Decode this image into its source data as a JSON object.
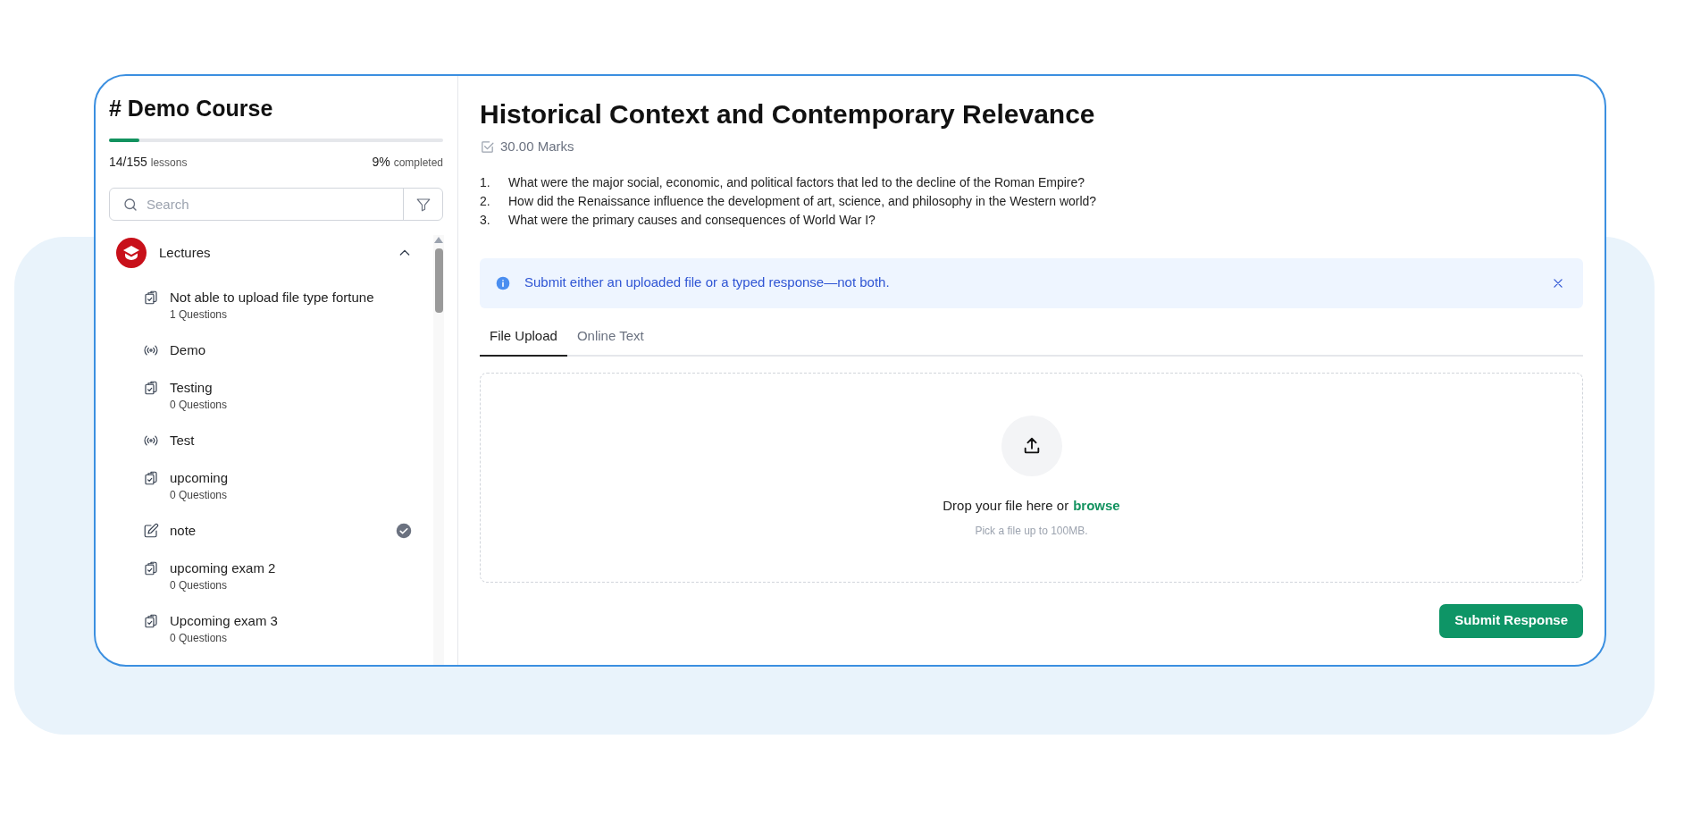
{
  "sidebar": {
    "title": "# Demo Course",
    "progress": {
      "level": 0.09,
      "count": "14/155",
      "count_label": "lessons",
      "percent": "9%",
      "percent_label": "completed"
    },
    "search": {
      "placeholder": "Search"
    },
    "section": {
      "title": "Lectures",
      "expanded": true,
      "items": [
        {
          "kind": "quiz",
          "title": "Not able to upload file type fortune",
          "subtitle": "1 Questions",
          "completed": false
        },
        {
          "kind": "live",
          "title": "Demo",
          "completed": false
        },
        {
          "kind": "quiz",
          "title": "Testing",
          "subtitle": "0 Questions",
          "completed": false
        },
        {
          "kind": "live",
          "title": "Test",
          "completed": false
        },
        {
          "kind": "quiz",
          "title": "upcoming",
          "subtitle": "0 Questions",
          "completed": false
        },
        {
          "kind": "note",
          "title": "note",
          "completed": true
        },
        {
          "kind": "quiz",
          "title": "upcoming exam 2",
          "subtitle": "0 Questions",
          "completed": false
        },
        {
          "kind": "quiz",
          "title": "Upcoming exam 3",
          "subtitle": "0 Questions",
          "completed": false
        }
      ]
    }
  },
  "main": {
    "title": "Historical Context and Contemporary Relevance",
    "marks": "30.00 Marks",
    "questions": [
      {
        "number": "1.",
        "text": "What were the major social, economic, and political factors that led to the decline of the Roman Empire?"
      },
      {
        "number": "2.",
        "text": "How did the Renaissance influence the development of art, science, and philosophy in the Western world?"
      },
      {
        "number": "3.",
        "text": "What were the primary causes and consequences of World War I?"
      }
    ],
    "alert": "Submit either an uploaded file or a typed response—not both.",
    "tabs": [
      {
        "label": "File Upload",
        "selected": true
      },
      {
        "label": "Online Text",
        "selected": false
      }
    ],
    "dropzone": {
      "text": "Drop your file here or",
      "link": "browse",
      "hint": "Pick a file up to 100MB."
    },
    "submit": "Submit Response"
  }
}
